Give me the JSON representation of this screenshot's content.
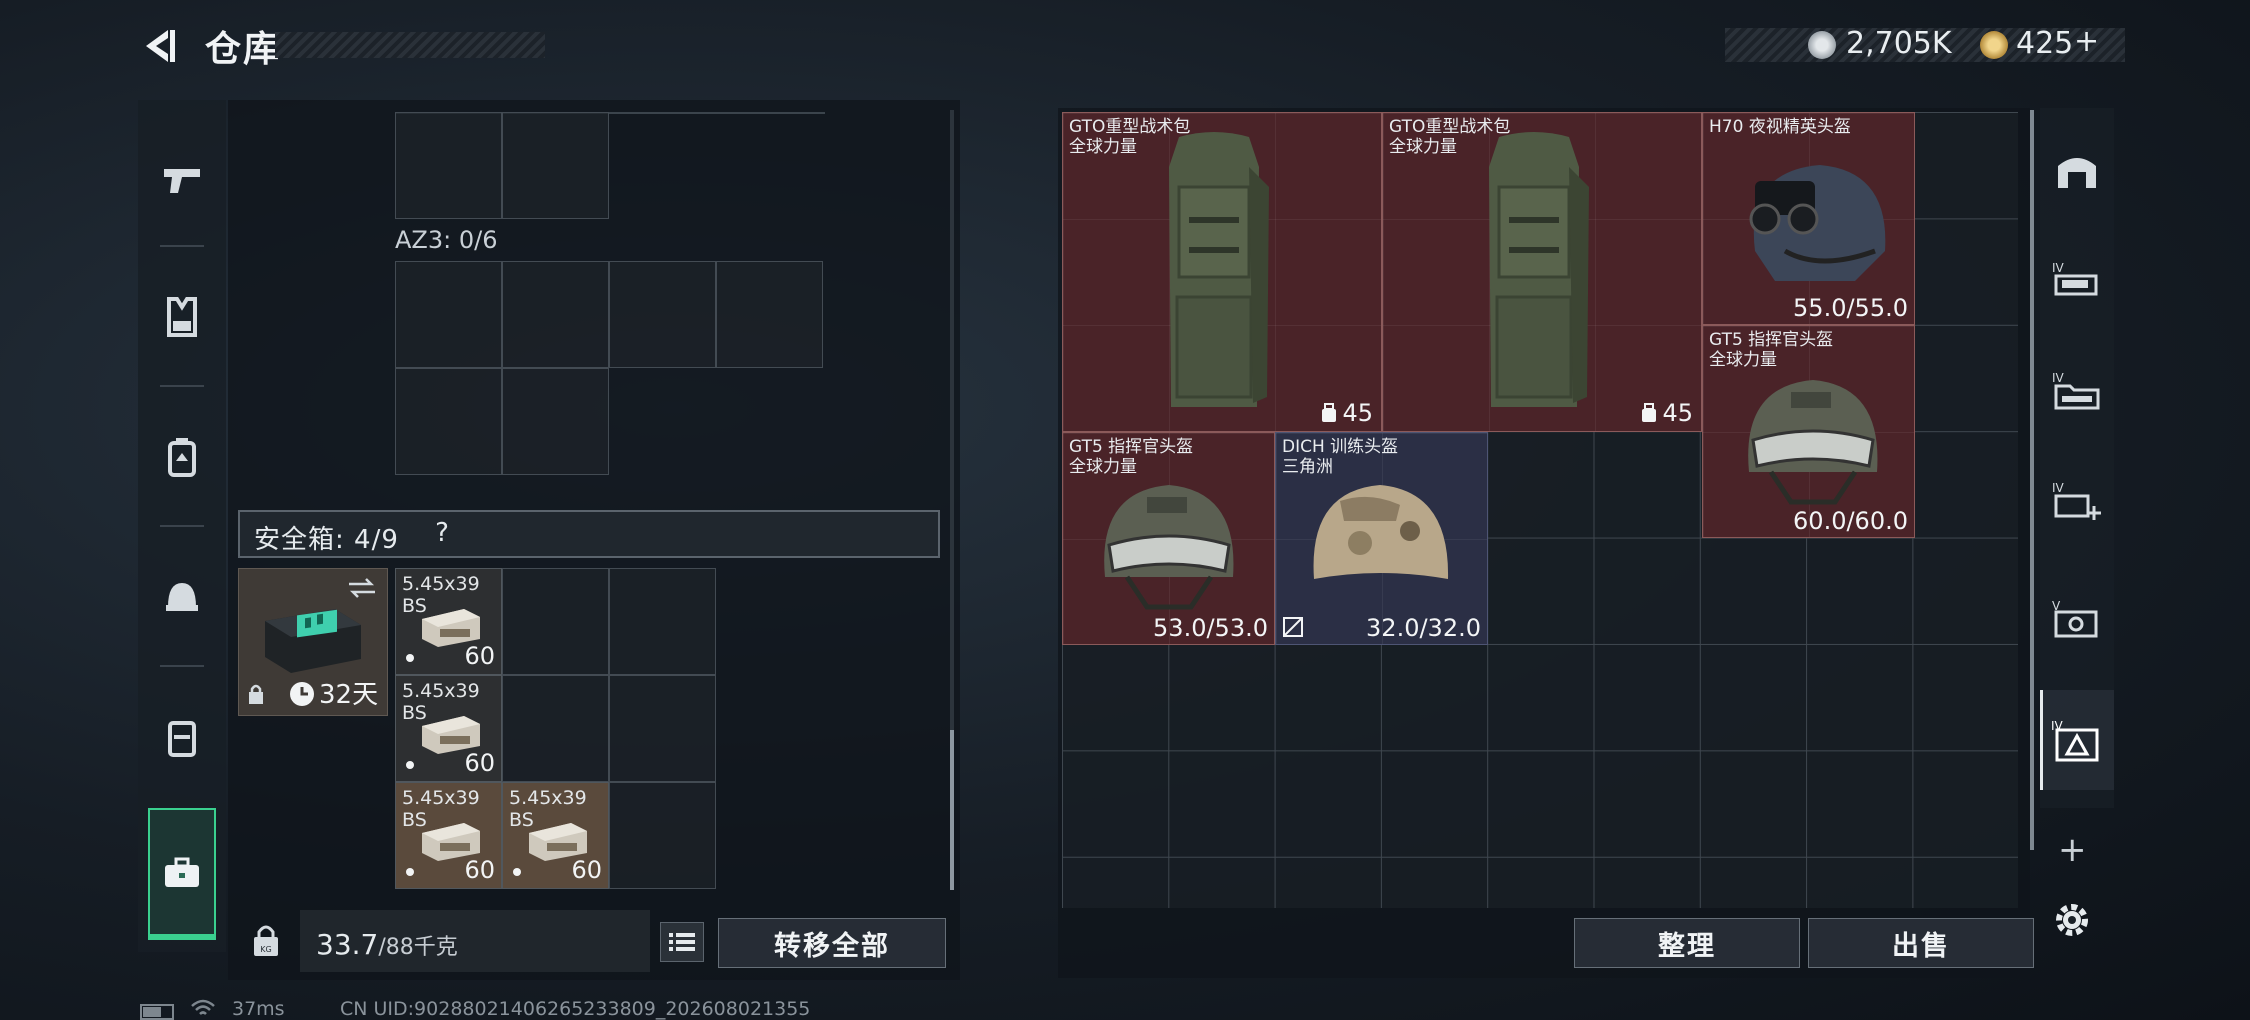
{
  "header": {
    "title": "仓库",
    "currency_silver": "2,705K",
    "currency_gold": "425",
    "add_symbol": "+"
  },
  "left_rail": {
    "items": [
      {
        "icon": "pistol-icon"
      },
      {
        "icon": "vest-icon"
      },
      {
        "icon": "backpack-icon"
      },
      {
        "icon": "helmet-icon"
      },
      {
        "icon": "rig-icon"
      },
      {
        "icon": "briefcase-icon"
      }
    ],
    "active_index": 5
  },
  "left_panel": {
    "az3_label": "AZ3: 0/6",
    "safebox_label": "安全箱: 4/9",
    "help_symbol": "?",
    "case_timer": "32天",
    "ammo": [
      {
        "name": "5.45x39",
        "sub": "BS",
        "count": "60"
      },
      {
        "name": "5.45x39",
        "sub": "BS",
        "count": "60"
      },
      {
        "name": "5.45x39",
        "sub": "BS",
        "count": "60"
      },
      {
        "name": "5.45x39",
        "sub": "BS",
        "count": "60"
      }
    ],
    "weight_current": "33.7",
    "weight_max": "/88千克",
    "transfer_all": "转移全部"
  },
  "storage": {
    "items": [
      {
        "name": "GTO重型战术包",
        "tag": "全球力量",
        "capacity": "45"
      },
      {
        "name": "GTO重型战术包",
        "tag": "全球力量",
        "capacity": "45"
      },
      {
        "name": "H70 夜视精英头盔",
        "durability": "55.0/55.0"
      },
      {
        "name": "GT5 指挥官头盔",
        "tag": "全球力量",
        "durability": "60.0/60.0"
      },
      {
        "name": "GT5 指挥官头盔",
        "tag": "全球力量",
        "durability": "53.0/53.0"
      },
      {
        "name": "DICH 训练头盔",
        "tag": "三角洲",
        "durability": "32.0/32.0"
      }
    ],
    "sort_button": "整理",
    "sell_button": "出售"
  },
  "right_rail": {
    "items": [
      {
        "icon": "storage-home-icon"
      },
      {
        "icon": "tier4-weapon-icon"
      },
      {
        "icon": "tier4-folder-icon"
      },
      {
        "icon": "tier4-add-icon"
      },
      {
        "icon": "tier5-case-icon"
      },
      {
        "icon": "tier4-triangle-icon"
      }
    ],
    "add_symbol": "+",
    "settings_icon": "gear-icon"
  },
  "status_bar": {
    "ping": "37ms",
    "uid": "CN UID:9028802140626523​3809_202608021355"
  }
}
